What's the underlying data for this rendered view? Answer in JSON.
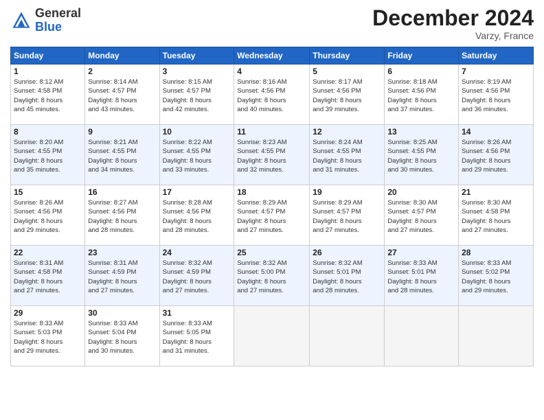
{
  "header": {
    "logo_line1": "General",
    "logo_line2": "Blue",
    "month": "December 2024",
    "location": "Varzy, France"
  },
  "days_of_week": [
    "Sunday",
    "Monday",
    "Tuesday",
    "Wednesday",
    "Thursday",
    "Friday",
    "Saturday"
  ],
  "weeks": [
    {
      "alt": false,
      "days": [
        {
          "num": "1",
          "info": "Sunrise: 8:12 AM\nSunset: 4:58 PM\nDaylight: 8 hours\nand 45 minutes."
        },
        {
          "num": "2",
          "info": "Sunrise: 8:14 AM\nSunset: 4:57 PM\nDaylight: 8 hours\nand 43 minutes."
        },
        {
          "num": "3",
          "info": "Sunrise: 8:15 AM\nSunset: 4:57 PM\nDaylight: 8 hours\nand 42 minutes."
        },
        {
          "num": "4",
          "info": "Sunrise: 8:16 AM\nSunset: 4:56 PM\nDaylight: 8 hours\nand 40 minutes."
        },
        {
          "num": "5",
          "info": "Sunrise: 8:17 AM\nSunset: 4:56 PM\nDaylight: 8 hours\nand 39 minutes."
        },
        {
          "num": "6",
          "info": "Sunrise: 8:18 AM\nSunset: 4:56 PM\nDaylight: 8 hours\nand 37 minutes."
        },
        {
          "num": "7",
          "info": "Sunrise: 8:19 AM\nSunset: 4:56 PM\nDaylight: 8 hours\nand 36 minutes."
        }
      ]
    },
    {
      "alt": true,
      "days": [
        {
          "num": "8",
          "info": "Sunrise: 8:20 AM\nSunset: 4:55 PM\nDaylight: 8 hours\nand 35 minutes."
        },
        {
          "num": "9",
          "info": "Sunrise: 8:21 AM\nSunset: 4:55 PM\nDaylight: 8 hours\nand 34 minutes."
        },
        {
          "num": "10",
          "info": "Sunrise: 8:22 AM\nSunset: 4:55 PM\nDaylight: 8 hours\nand 33 minutes."
        },
        {
          "num": "11",
          "info": "Sunrise: 8:23 AM\nSunset: 4:55 PM\nDaylight: 8 hours\nand 32 minutes."
        },
        {
          "num": "12",
          "info": "Sunrise: 8:24 AM\nSunset: 4:55 PM\nDaylight: 8 hours\nand 31 minutes."
        },
        {
          "num": "13",
          "info": "Sunrise: 8:25 AM\nSunset: 4:55 PM\nDaylight: 8 hours\nand 30 minutes."
        },
        {
          "num": "14",
          "info": "Sunrise: 8:26 AM\nSunset: 4:56 PM\nDaylight: 8 hours\nand 29 minutes."
        }
      ]
    },
    {
      "alt": false,
      "days": [
        {
          "num": "15",
          "info": "Sunrise: 8:26 AM\nSunset: 4:56 PM\nDaylight: 8 hours\nand 29 minutes."
        },
        {
          "num": "16",
          "info": "Sunrise: 8:27 AM\nSunset: 4:56 PM\nDaylight: 8 hours\nand 28 minutes."
        },
        {
          "num": "17",
          "info": "Sunrise: 8:28 AM\nSunset: 4:56 PM\nDaylight: 8 hours\nand 28 minutes."
        },
        {
          "num": "18",
          "info": "Sunrise: 8:29 AM\nSunset: 4:57 PM\nDaylight: 8 hours\nand 27 minutes."
        },
        {
          "num": "19",
          "info": "Sunrise: 8:29 AM\nSunset: 4:57 PM\nDaylight: 8 hours\nand 27 minutes."
        },
        {
          "num": "20",
          "info": "Sunrise: 8:30 AM\nSunset: 4:57 PM\nDaylight: 8 hours\nand 27 minutes."
        },
        {
          "num": "21",
          "info": "Sunrise: 8:30 AM\nSunset: 4:58 PM\nDaylight: 8 hours\nand 27 minutes."
        }
      ]
    },
    {
      "alt": true,
      "days": [
        {
          "num": "22",
          "info": "Sunrise: 8:31 AM\nSunset: 4:58 PM\nDaylight: 8 hours\nand 27 minutes."
        },
        {
          "num": "23",
          "info": "Sunrise: 8:31 AM\nSunset: 4:59 PM\nDaylight: 8 hours\nand 27 minutes."
        },
        {
          "num": "24",
          "info": "Sunrise: 8:32 AM\nSunset: 4:59 PM\nDaylight: 8 hours\nand 27 minutes."
        },
        {
          "num": "25",
          "info": "Sunrise: 8:32 AM\nSunset: 5:00 PM\nDaylight: 8 hours\nand 27 minutes."
        },
        {
          "num": "26",
          "info": "Sunrise: 8:32 AM\nSunset: 5:01 PM\nDaylight: 8 hours\nand 28 minutes."
        },
        {
          "num": "27",
          "info": "Sunrise: 8:33 AM\nSunset: 5:01 PM\nDaylight: 8 hours\nand 28 minutes."
        },
        {
          "num": "28",
          "info": "Sunrise: 8:33 AM\nSunset: 5:02 PM\nDaylight: 8 hours\nand 29 minutes."
        }
      ]
    },
    {
      "alt": false,
      "days": [
        {
          "num": "29",
          "info": "Sunrise: 8:33 AM\nSunset: 5:03 PM\nDaylight: 8 hours\nand 29 minutes."
        },
        {
          "num": "30",
          "info": "Sunrise: 8:33 AM\nSunset: 5:04 PM\nDaylight: 8 hours\nand 30 minutes."
        },
        {
          "num": "31",
          "info": "Sunrise: 8:33 AM\nSunset: 5:05 PM\nDaylight: 8 hours\nand 31 minutes."
        },
        null,
        null,
        null,
        null
      ]
    }
  ]
}
